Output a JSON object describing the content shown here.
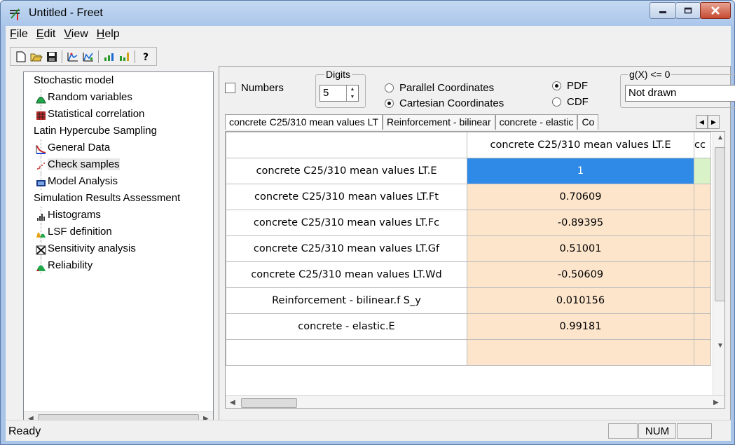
{
  "window": {
    "title": "Untitled - Freet"
  },
  "menu": [
    {
      "key": "F",
      "rest": "ile"
    },
    {
      "key": "E",
      "rest": "dit"
    },
    {
      "key": "V",
      "rest": "iew"
    },
    {
      "key": "H",
      "rest": "elp"
    }
  ],
  "toolbar": {
    "buttons": [
      "new-icon",
      "open-icon",
      "save-icon",
      "chart-a-icon",
      "chart-b-icon",
      "bars-a-icon",
      "bars-b-icon",
      "help-icon"
    ]
  },
  "tree": {
    "items": [
      {
        "label": "Stochastic model",
        "level": "root",
        "icon": ""
      },
      {
        "label": "Random variables",
        "level": "child",
        "icon": "pdf-green-icon"
      },
      {
        "label": "Statistical correlation",
        "level": "child",
        "icon": "correlation-grid-icon"
      },
      {
        "label": "Latin Hypercube Sampling",
        "level": "root",
        "icon": ""
      },
      {
        "label": "General Data",
        "level": "child",
        "icon": "general-data-icon"
      },
      {
        "label": "Check samples",
        "level": "child",
        "icon": "scatter-icon"
      },
      {
        "label": "Model Analysis",
        "level": "child",
        "icon": "model-analysis-icon"
      },
      {
        "label": "Simulation Results Assessment",
        "level": "root",
        "icon": ""
      },
      {
        "label": "Histograms",
        "level": "child",
        "icon": "histogram-icon"
      },
      {
        "label": "LSF definition",
        "level": "child",
        "icon": "lsf-icon"
      },
      {
        "label": "Sensitivity analysis",
        "level": "child",
        "icon": "sensitivity-icon"
      },
      {
        "label": "Reliability",
        "level": "child",
        "icon": "reliability-icon"
      }
    ]
  },
  "options": {
    "numbers_label": "Numbers",
    "digits_legend": "Digits",
    "digits_value": "5",
    "parallel_label": "Parallel Coordinates",
    "cartesian_label": "Cartesian Coordinates",
    "pdf_label": "PDF",
    "cdf_label": "CDF",
    "g_legend": "g(X) <= 0",
    "g_value": "Not drawn"
  },
  "tabs": [
    "concrete C25/310 mean values LT",
    "Reinforcement - bilinear",
    "concrete - elastic",
    "Co"
  ],
  "grid": {
    "col_header": "concrete C25/310 mean values LT.E",
    "col_cut": "cc",
    "rows": [
      {
        "label": "concrete C25/310 mean values LT.E",
        "value": "1"
      },
      {
        "label": "concrete C25/310 mean values LT.Ft",
        "value": "0.70609"
      },
      {
        "label": "concrete C25/310 mean values LT.Fc",
        "value": "-0.89395"
      },
      {
        "label": "concrete C25/310 mean values LT.Gf",
        "value": "0.51001"
      },
      {
        "label": "concrete C25/310 mean values LT.Wd",
        "value": "-0.50609"
      },
      {
        "label": "Reinforcement - bilinear.f S_y",
        "value": "0.010156"
      },
      {
        "label": "concrete - elastic.E",
        "value": "0.99181"
      },
      {
        "label": "",
        "value": ""
      }
    ]
  },
  "status": {
    "text": "Ready",
    "num": "NUM"
  }
}
